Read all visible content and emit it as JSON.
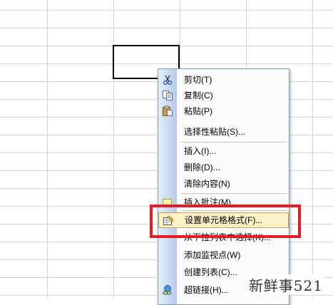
{
  "context_menu": {
    "items": [
      {
        "label": "剪切(T)",
        "icon": "scissors-icon"
      },
      {
        "label": "复制(C)",
        "icon": "copy-icon"
      },
      {
        "label": "粘贴(P)",
        "icon": "paste-icon"
      },
      {
        "label": "选择性粘贴(S)...",
        "icon": ""
      },
      {
        "label": "插入(I)...",
        "icon": ""
      },
      {
        "label": "删除(D)...",
        "icon": ""
      },
      {
        "label": "清除内容(N)",
        "icon": ""
      },
      {
        "label": "插入批注(M)",
        "icon": "insert-comment-icon"
      },
      {
        "label": "设置单元格格式(F)...",
        "icon": "format-cells-icon"
      },
      {
        "label": "从下拉列表中选择(K)...",
        "icon": ""
      },
      {
        "label": "添加监视点(W)",
        "icon": ""
      },
      {
        "label": "创建列表(C)...",
        "icon": ""
      },
      {
        "label": "超链接(H)...",
        "icon": "hyperlink-icon"
      }
    ]
  },
  "watermark": {
    "text": "新鲜事521"
  },
  "colors": {
    "highlight_border": "#e51c23",
    "hover_background": "#fff1c7",
    "gutter_start": "#e3eefb",
    "gutter_end": "#b6cbe8"
  }
}
